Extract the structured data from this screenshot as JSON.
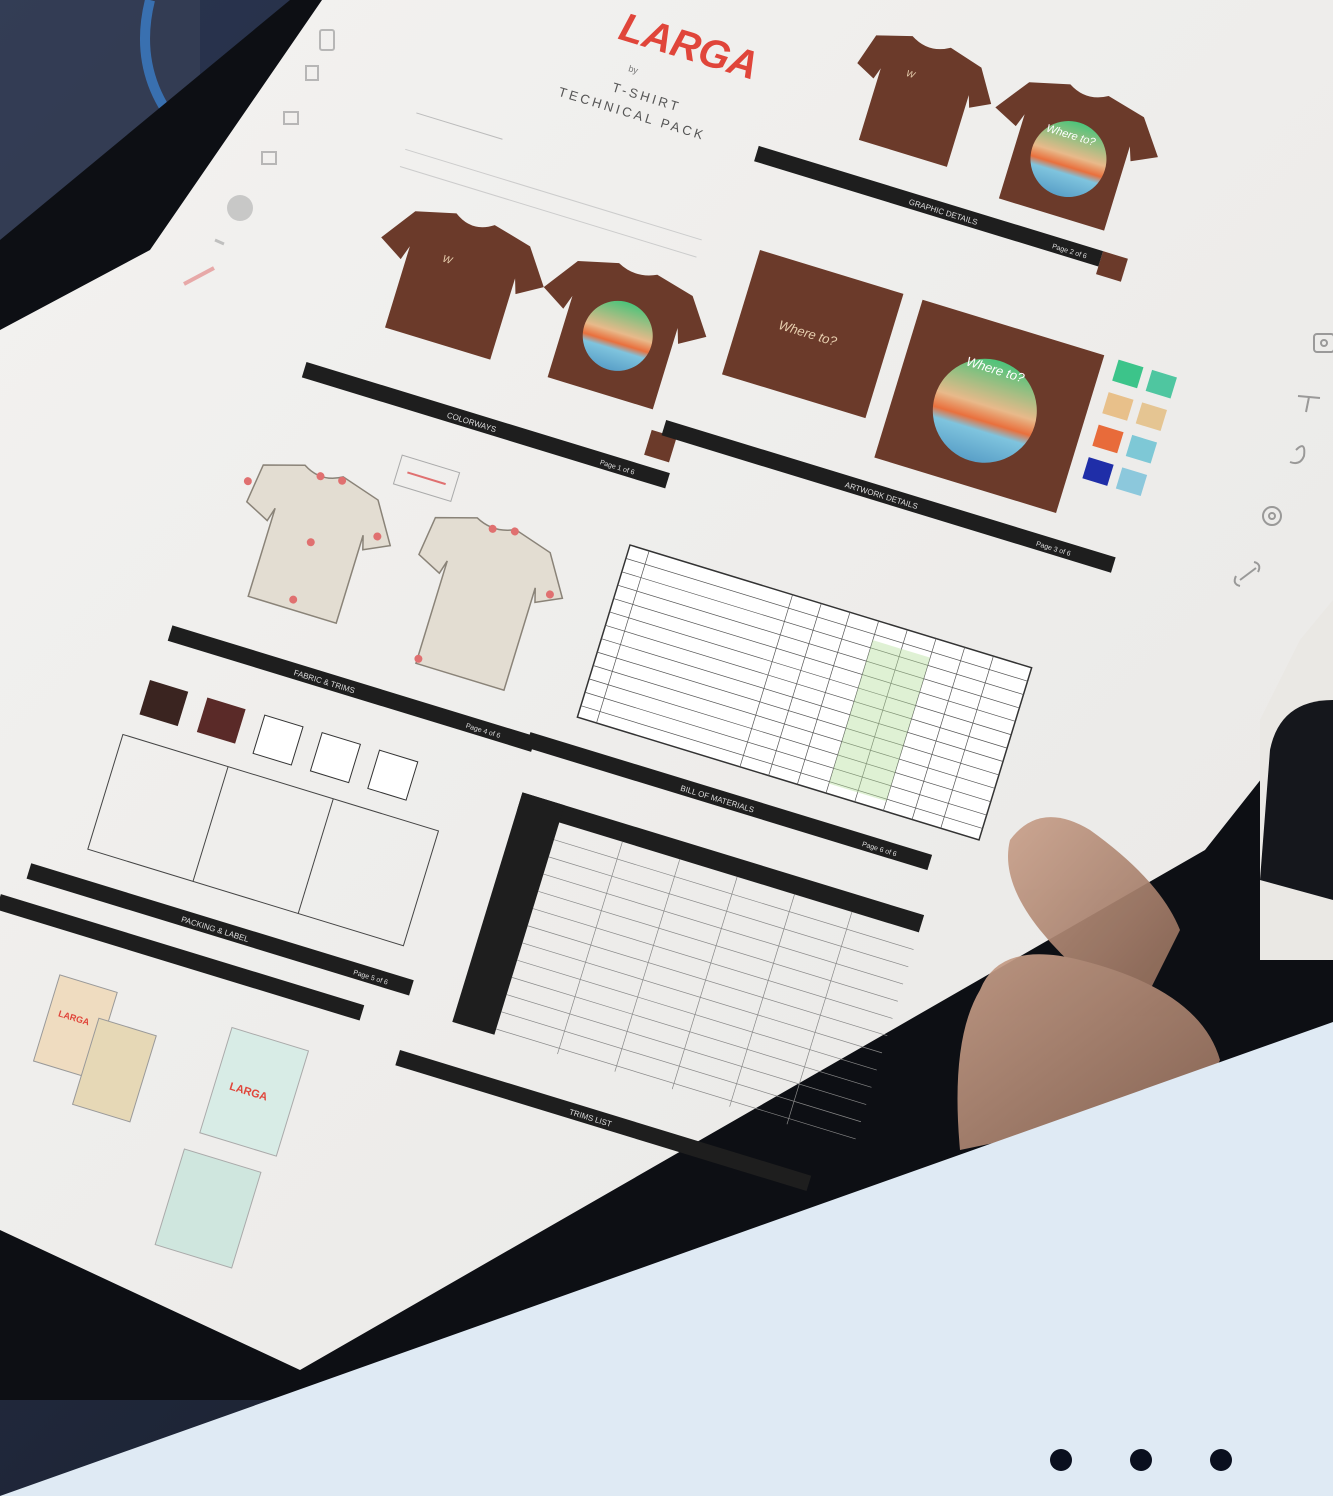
{
  "document": {
    "brand": "LARGA",
    "byline": "by",
    "subtitle_line1": "T-SHIRT",
    "subtitle_line2": "TECHNICAL PACK",
    "sections": {
      "colorways": "COLORWAYS",
      "graphic_details": "GRAPHIC DETAILS",
      "artwork_details": "ARTWORK DETAILS",
      "fabric_trims": "FABRIC & TRIMS",
      "bill_of_materials": "BILL OF MATERIALS",
      "packing_label": "PACKING & LABEL",
      "trims_list": "TRIMS LIST"
    },
    "pages": {
      "p1": "Page 1 of 6",
      "p2": "Page 2 of 6",
      "p3": "Page 3 of 6",
      "p4": "Page 4 of 6",
      "p5": "Page 5 of 6",
      "p6": "Page 6 of 6"
    },
    "graphic_text": "Where to?",
    "hangtag_brand": "LARGA"
  },
  "colors": {
    "brand_red": "#e0453a",
    "tshirt_brown": "#6b3a2a",
    "swatches": [
      "#3cc48a",
      "#4fc6a0",
      "#e8c08a",
      "#e5c592",
      "#e86b3a",
      "#7ec8d6",
      "#1f2ea8",
      "#8cc8dc"
    ],
    "overlay": "#dfeaf4",
    "dot": "#0a0f1e"
  },
  "toolbar": {
    "icons": [
      "image-icon",
      "text-icon",
      "lasso-icon",
      "settings-icon",
      "link-icon"
    ]
  },
  "pagination": {
    "count": 3,
    "active": 0
  }
}
